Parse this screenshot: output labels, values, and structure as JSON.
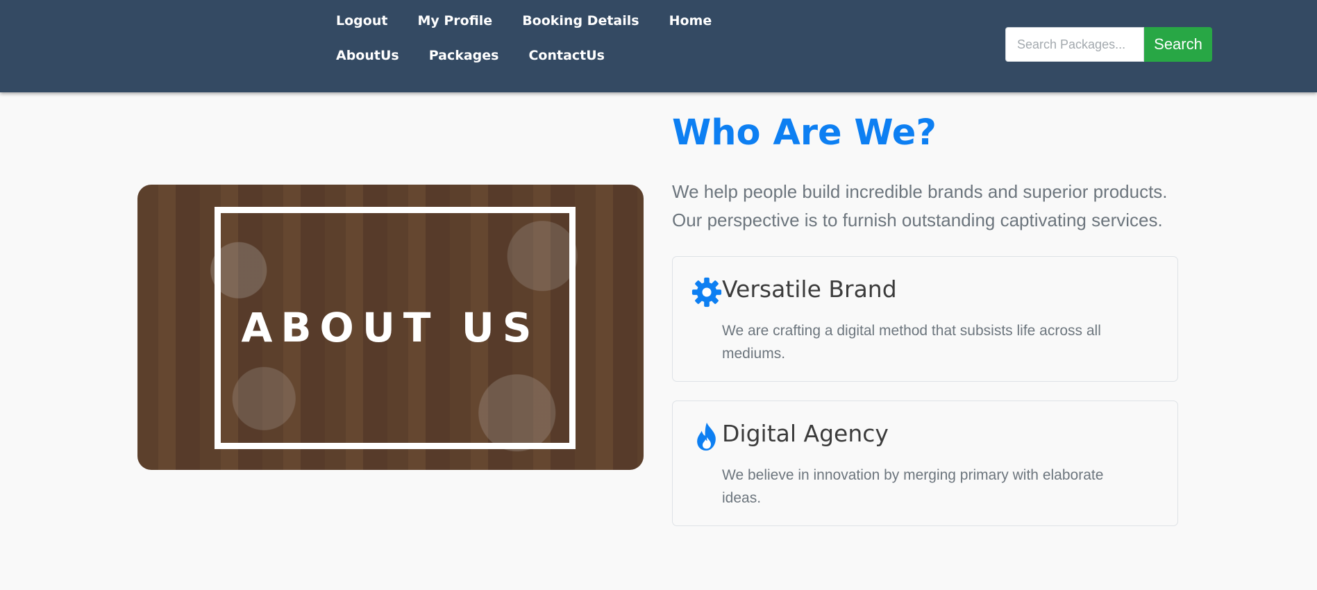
{
  "nav": {
    "links": [
      {
        "label": "Logout"
      },
      {
        "label": "My Profile"
      },
      {
        "label": "Booking Details"
      },
      {
        "label": "Home"
      },
      {
        "label": "AboutUs"
      },
      {
        "label": "Packages"
      },
      {
        "label": "ContactUs"
      }
    ],
    "search": {
      "placeholder": "Search Packages...",
      "value": "",
      "button_label": "Search"
    }
  },
  "hero": {
    "image_text": "ABOUT US"
  },
  "about": {
    "title": "Who Are We?",
    "lead": "We help people build incredible brands and superior products. Our perspective is to furnish outstanding captivating services.",
    "features": [
      {
        "icon": "gear-icon",
        "title": "Versatile Brand",
        "text": "We are crafting a digital method that subsists life across all mediums."
      },
      {
        "icon": "fire-icon",
        "title": "Digital Agency",
        "text": "We believe in innovation by merging primary with elaborate ideas."
      }
    ]
  },
  "colors": {
    "navbar": "#344a63",
    "accent": "#0d7ff2",
    "search_button": "#28a745",
    "background": "#f9f9f9"
  }
}
